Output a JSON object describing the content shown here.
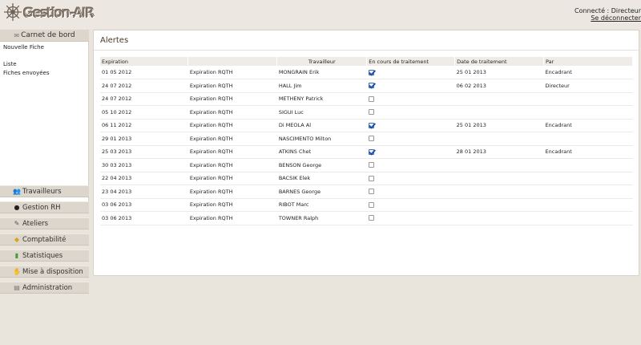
{
  "header": {
    "app_title": "Gestion-AIR",
    "connected": "Connecté : Directeur",
    "logout": "Se déconnecter"
  },
  "sidebar": {
    "carnet": {
      "label": "Carnet de bord",
      "icon": "envelope-icon",
      "links": [
        "Nouvelle Fiche",
        "Liste",
        "Fiches envoyées"
      ]
    },
    "menu": [
      {
        "label": "Travailleurs",
        "icon": "people-icon"
      },
      {
        "label": "Gestion RH",
        "icon": "person-hat-icon"
      },
      {
        "label": "Ateliers",
        "icon": "tools-icon"
      },
      {
        "label": "Comptabilité",
        "icon": "coins-icon"
      },
      {
        "label": "Statistiques",
        "icon": "bar-chart-icon"
      },
      {
        "label": "Mise à disposition",
        "icon": "handshake-icon"
      },
      {
        "label": "Administration",
        "icon": "admin-icon"
      }
    ]
  },
  "main": {
    "title": "Alertes",
    "columns": [
      "Expiration",
      "",
      "Travailleur",
      "En cours de traitement",
      "Date de traitement",
      "Par"
    ],
    "rows": [
      {
        "expiration": "01 05 2012",
        "type": "Expiration RQTH",
        "worker": "MONGRAIN Erik",
        "in_progress": true,
        "date": "25 01 2013",
        "by": "Encadrant"
      },
      {
        "expiration": "24 07 2012",
        "type": "Expiration RQTH",
        "worker": "HALL Jim",
        "in_progress": true,
        "date": "06 02 2013",
        "by": "Directeur"
      },
      {
        "expiration": "24 07 2012",
        "type": "Expiration RQTH",
        "worker": "METHENY Patrick",
        "in_progress": false,
        "date": "",
        "by": ""
      },
      {
        "expiration": "05 10 2012",
        "type": "Expiration RQTH",
        "worker": "SIGUI Luc",
        "in_progress": false,
        "date": "",
        "by": ""
      },
      {
        "expiration": "06 11 2012",
        "type": "Expiration RQTH",
        "worker": "Di MEOLA Al",
        "in_progress": true,
        "date": "25 01 2013",
        "by": "Encadrant"
      },
      {
        "expiration": "29 01 2013",
        "type": "Expiration RQTH",
        "worker": "NASCIMENTO Milton",
        "in_progress": false,
        "date": "",
        "by": ""
      },
      {
        "expiration": "25 03 2013",
        "type": "Expiration RQTH",
        "worker": "ATKINS Chet",
        "in_progress": true,
        "date": "28 01 2013",
        "by": "Encadrant"
      },
      {
        "expiration": "30 03 2013",
        "type": "Expiration RQTH",
        "worker": "BENSON George",
        "in_progress": false,
        "date": "",
        "by": ""
      },
      {
        "expiration": "22 04 2013",
        "type": "Expiration RQTH",
        "worker": "BACSIK Elek",
        "in_progress": false,
        "date": "",
        "by": ""
      },
      {
        "expiration": "23 04 2013",
        "type": "Expiration RQTH",
        "worker": "BARNES George",
        "in_progress": false,
        "date": "",
        "by": ""
      },
      {
        "expiration": "03 06 2013",
        "type": "Expiration RQTH",
        "worker": "RIBOT Marc",
        "in_progress": false,
        "date": "",
        "by": ""
      },
      {
        "expiration": "03 06 2013",
        "type": "Expiration RQTH",
        "worker": "TOWNER Ralph",
        "in_progress": false,
        "date": "",
        "by": ""
      }
    ]
  },
  "colors": {
    "background": "#e9e4dc",
    "sidebar_item": "#dcd6cc",
    "title": "#4a3b2c",
    "checkbox_check": "#1f4fa8"
  }
}
